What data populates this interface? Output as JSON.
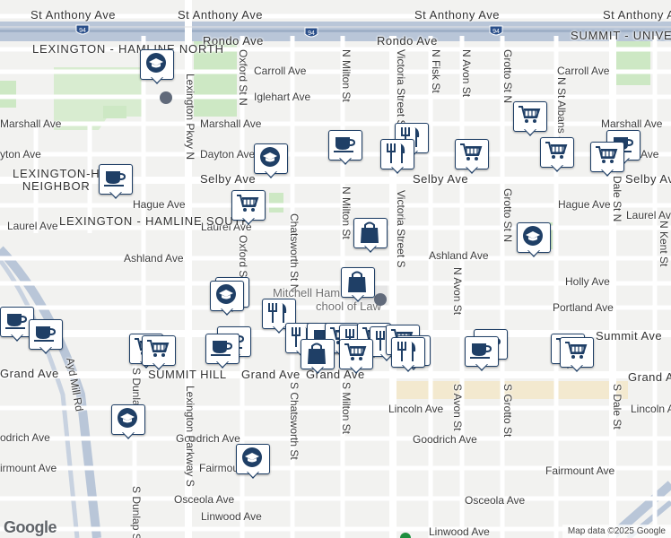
{
  "map": {
    "interstate_shield": "94",
    "streets_horizontal": [
      "St Anthony Ave",
      "Rondo Ave",
      "Carroll Ave",
      "Iglehart Ave",
      "Marshall Ave",
      "Dayton Ave",
      "Selby Ave",
      "Hague Ave",
      "Laurel Ave",
      "Ashland Ave",
      "Holly Ave",
      "Portland Ave",
      "Summit Ave",
      "Grand Ave",
      "Lincoln Ave",
      "Goodrich Ave",
      "Fairmount Ave",
      "Osceola Ave",
      "Linwood Ave"
    ],
    "labels": {
      "st_anthony_1": "St Anthony Ave",
      "st_anthony_2": "St Anthony Ave",
      "st_anthony_3": "St Anthony Ave",
      "st_anthony_4": "St Anthony Ave",
      "rondo": "Rondo Ave",
      "carroll_1": "Carroll Ave",
      "carroll_2": "Carroll Ave",
      "iglehart": "Iglehart Ave",
      "marshall_1": "Marshall Ave",
      "marshall_2": "Marshall Ave",
      "marshall_3": "Marshall Ave",
      "dayton_1": "Dayton Ave",
      "dayton_2": "Dayton Ave",
      "dayton_3": "Dayton Ave",
      "dayton_4": "yton Ave",
      "selby_1": "Selby Ave",
      "selby_2": "Selby Ave",
      "selby_3": "Selby Ave",
      "hague_1": "Hague Ave",
      "hague_2": "Hague Ave",
      "laurel_1": "Laurel Ave",
      "laurel_2": "Laurel Ave",
      "laurel_3": "Laurel Ave",
      "ashland_1": "Ashland Ave",
      "ashland_2": "Ashland Ave",
      "holly": "Holly Ave",
      "portland": "Portland Ave",
      "summit_1": "Summit Ave",
      "summit_2": "Ave",
      "summit_hill": "SUMMIT HILL",
      "grand_1": "Grand Ave",
      "grand_2": "Grand Ave",
      "grand_3": "Grand Ave",
      "grand_4": "Grand Av",
      "grand_west": "Grand Ave",
      "lincoln_1": "Lincoln Ave",
      "lincoln_2": "Lincoln Ave",
      "goodrich_1": "Goodrich Ave",
      "goodrich_2": "Goodrich Ave",
      "goodrich_3": "odrich Ave",
      "fairmount_1": "Fairmount Ave",
      "fairmount_2": "Fairmount",
      "fairmount_3": "irmount Ave",
      "osceola_1": "Osceola Ave",
      "osceola_2": "Osceola Ave",
      "linwood_1": "Linwood Ave",
      "linwood_2": "Linwood Ave",
      "lexington_pkwy_n": "Lexington Pkwy N",
      "lexington_parkway_s": "Lexington Parkway S",
      "oxford_n_1": "Oxford St N",
      "oxford_n_2": "Oxford St N",
      "chatsworth_n": "Chatsworth St N",
      "chatsworth_s": "S Chatsworth St",
      "milton_n_1": "N Milton St",
      "milton_n_2": "N Milton St",
      "milton_s": "S Milton St",
      "victoria_s": "Victoria Street S",
      "victoria_s_2": "Victoria Street S",
      "fisk_n": "N Fisk St",
      "avon_n": "N Avon St",
      "avon_s_1": "N Avon St",
      "avon_s_2": "S Avon St",
      "grotto_n_1": "Grotto St N",
      "grotto_n_2": "Grotto St N",
      "grotto_s": "S Grotto St",
      "st_albans": "N St Albans St",
      "dale_n": "Dale St N",
      "dale_s": "S Dale St",
      "kent": "N Kent St",
      "dunlap_1": "S Dunlap St",
      "dunlap_2": "S Dunlap St",
      "ayd_mill": "Ayd Mill Rd",
      "hood_lex_hamline_north": "LEXINGTON - HAMLINE NORTH",
      "hood_lex_hamline_neighbor_1": "LEXINGTON-H",
      "hood_lex_hamline_neighbor_2": "NEIGHBOR",
      "hood_lex_hamline_south": "LEXINGTON - HAMLINE SOUTH",
      "hood_summit_university": "SUMMIT - UNIVERSITY",
      "campus_1": "Mitchell Ham",
      "campus_2": "chool of Law",
      "google": "Google",
      "attribution": "Map data ©2025 Google"
    },
    "pin_types": [
      "shopping-cart",
      "restaurant",
      "cafe",
      "shopping-bag",
      "school"
    ],
    "accent_color": "#1f3f66",
    "road_color": "#ffffff",
    "highway_color": "#b9c6d8",
    "park_color": "#cde8c4",
    "campus_color": "#f3e9cf"
  }
}
